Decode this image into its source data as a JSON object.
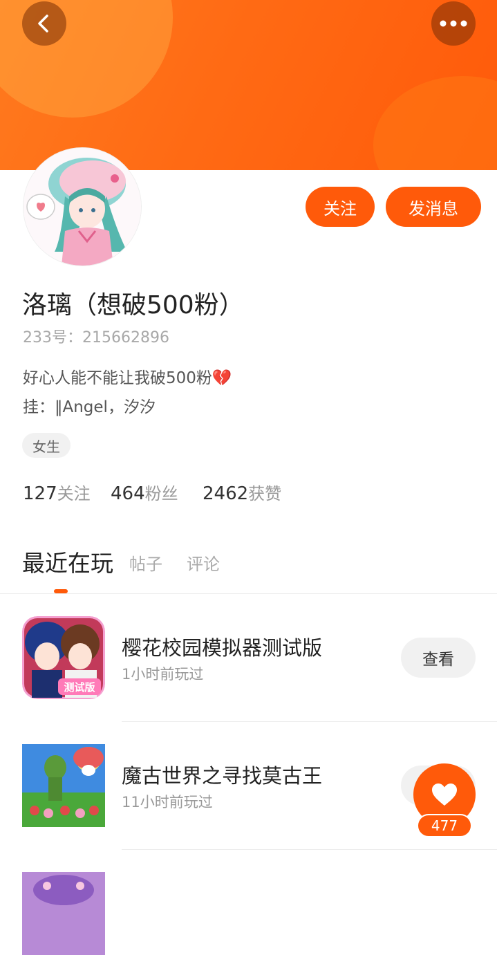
{
  "profile": {
    "name": "洛璃（想破500粉）",
    "uid_text": "233号：215662896",
    "bio_line1": "好心人能不能让我破500粉💔",
    "bio_line2": "挂：‖Angel，汐汐",
    "gender_tag": "女生"
  },
  "actions": {
    "follow_label": "关注",
    "message_label": "发消息"
  },
  "stats": [
    {
      "value": "127",
      "label": "关注"
    },
    {
      "value": "464",
      "label": "粉丝"
    },
    {
      "value": "2462",
      "label": "获赞"
    }
  ],
  "tabs": [
    {
      "label": "最近在玩",
      "active": true
    },
    {
      "label": "帖子",
      "active": false
    },
    {
      "label": "评论",
      "active": false
    }
  ],
  "games": [
    {
      "title": "樱花校园模拟器测试版",
      "time": "1小时前玩过",
      "button": "查看",
      "icon": "sakura-school-icon",
      "icon_badge": "测试版"
    },
    {
      "title": "魔古世界之寻找莫古王",
      "time": "11小时前玩过",
      "button": "查看",
      "icon": "mogu-world-icon"
    },
    {
      "title": "",
      "time": "",
      "button": "",
      "icon": "purple-game-icon"
    }
  ],
  "like": {
    "count": "477"
  },
  "colors": {
    "accent": "#ff5a0a",
    "banner": "#ff6a14"
  },
  "icons": {
    "back": "back-arrow-icon",
    "more": "more-dots-icon",
    "like": "heart-icon"
  }
}
